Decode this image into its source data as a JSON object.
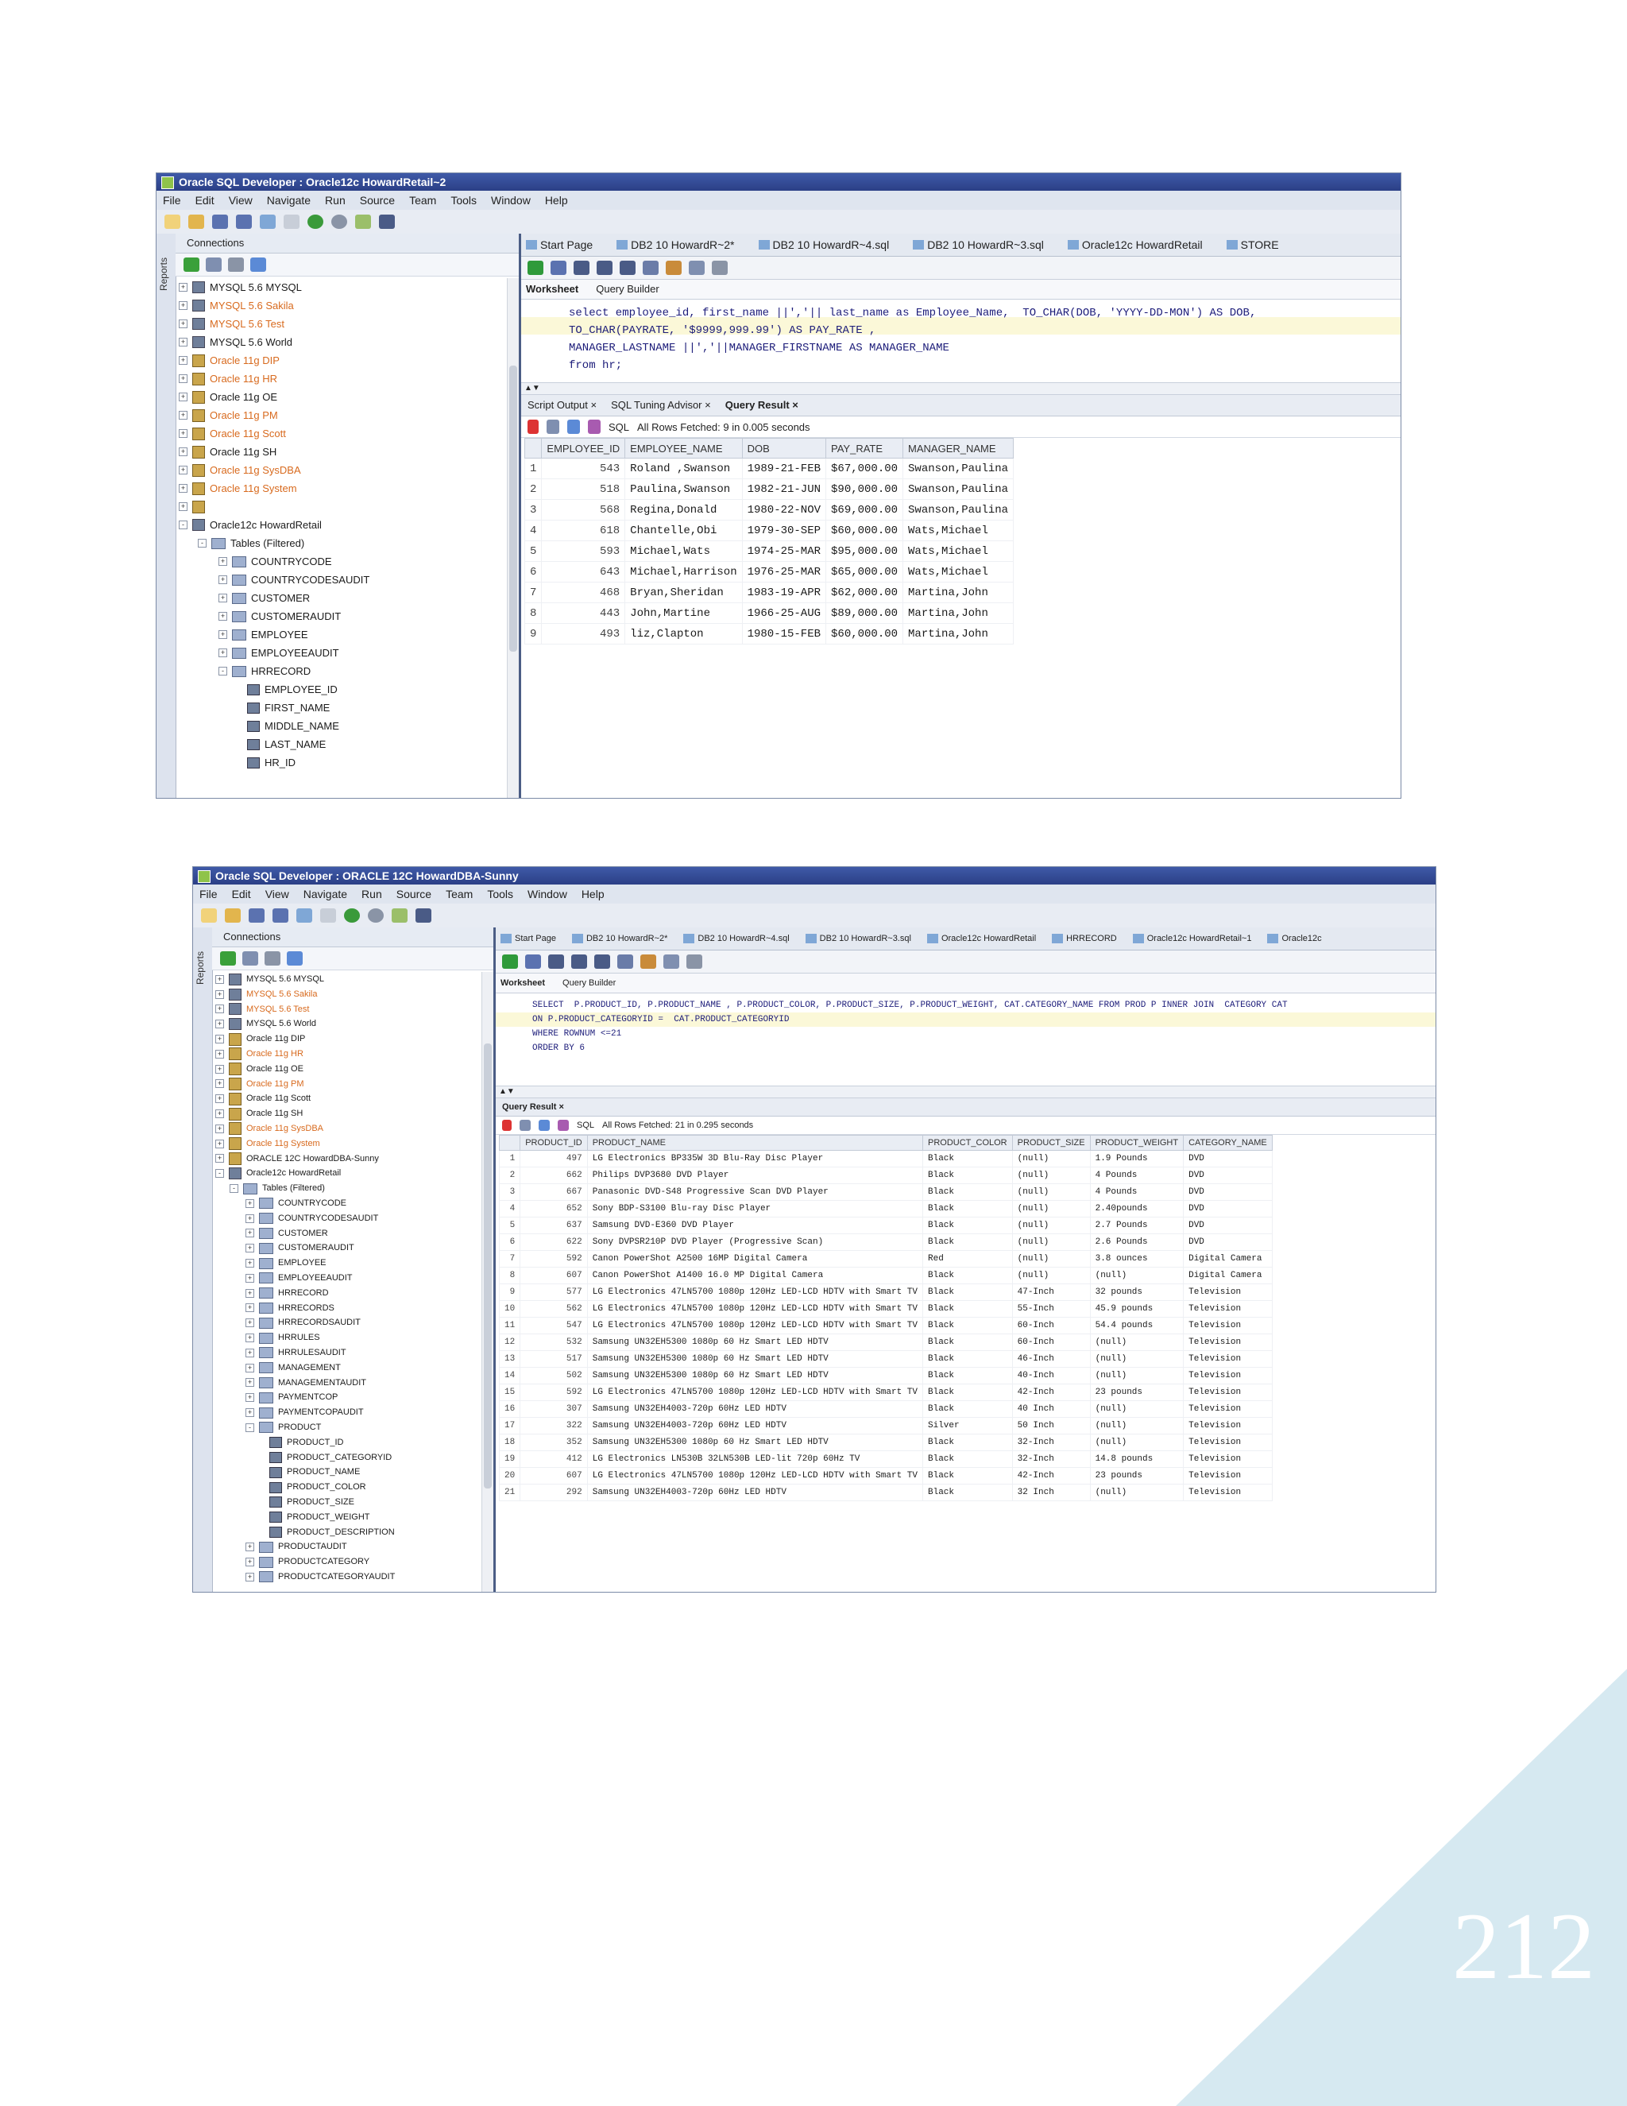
{
  "page_number": "212",
  "colors": {
    "title_bar": "#2b3f86",
    "corner_accent": "#d6e9f1",
    "orange_connection": "#d86a1e"
  },
  "screenshot1": {
    "title": "Oracle SQL Developer : Oracle12c HowardRetail~2",
    "menu": [
      "File",
      "Edit",
      "View",
      "Navigate",
      "Run",
      "Source",
      "Team",
      "Tools",
      "Window",
      "Help"
    ],
    "side_tab": "Reports",
    "connections_title": "Connections",
    "tree": [
      {
        "label": "MYSQL 5.6 MYSQL",
        "style": "dark"
      },
      {
        "label": "MYSQL 5.6 Sakila",
        "style": "orange"
      },
      {
        "label": "MYSQL 5.6 Test",
        "style": "orange"
      },
      {
        "label": "MYSQL 5.6 World",
        "style": "dark"
      },
      {
        "label": "Oracle 11g DIP",
        "style": "orange"
      },
      {
        "label": "Oracle 11g HR",
        "style": "orange"
      },
      {
        "label": "Oracle 11g OE",
        "style": "dark"
      },
      {
        "label": "Oracle 11g PM",
        "style": "orange"
      },
      {
        "label": "Oracle 11g Scott",
        "style": "orange"
      },
      {
        "label": "Oracle 11g SH",
        "style": "dark"
      },
      {
        "label": "Oracle 11g SysDBA",
        "style": "orange"
      },
      {
        "label": "Oracle 11g System",
        "style": "orange"
      },
      {
        "label": "",
        "style": "dark"
      },
      {
        "label": "Oracle12c HowardRetail",
        "style": "dark"
      },
      {
        "label": "Tables (Filtered)",
        "style": "dark"
      },
      {
        "label": "COUNTRYCODE",
        "style": "dark"
      },
      {
        "label": "COUNTRYCODESAUDIT",
        "style": "dark"
      },
      {
        "label": "CUSTOMER",
        "style": "dark"
      },
      {
        "label": "CUSTOMERAUDIT",
        "style": "dark"
      },
      {
        "label": "EMPLOYEE",
        "style": "dark"
      },
      {
        "label": "EMPLOYEEAUDIT",
        "style": "dark"
      },
      {
        "label": "HRRECORD",
        "style": "dark"
      },
      {
        "label": "EMPLOYEE_ID",
        "style": "dark"
      },
      {
        "label": "FIRST_NAME",
        "style": "dark"
      },
      {
        "label": "MIDDLE_NAME",
        "style": "dark"
      },
      {
        "label": "LAST_NAME",
        "style": "dark"
      },
      {
        "label": "HR_ID",
        "style": "dark"
      }
    ],
    "doc_tabs": [
      "Start Page",
      "DB2 10 HowardR~2*",
      "DB2 10 HowardR~4.sql",
      "DB2 10 HowardR~3.sql",
      "Oracle12c HowardRetail",
      "STORE"
    ],
    "sub_tabs": [
      "Worksheet",
      "Query Builder"
    ],
    "sql": [
      "select employee_id, first_name ||','|| last_name as Employee_Name,  TO_CHAR(DOB, 'YYYY-DD-MON') AS DOB,",
      "TO_CHAR(PAYRATE, '$9999,999.99') AS PAY_RATE ,",
      "MANAGER_LASTNAME ||','||MANAGER_FIRSTNAME AS MANAGER_NAME",
      "from hr;"
    ],
    "result_tabs": [
      "Script Output",
      "SQL Tuning Advisor",
      "Query Result"
    ],
    "sql_label": "SQL",
    "status": "All Rows Fetched: 9 in 0.005 seconds",
    "columns": [
      "EMPLOYEE_ID",
      "EMPLOYEE_NAME",
      "DOB",
      "PAY_RATE",
      "MANAGER_NAME"
    ],
    "rows": [
      [
        "1",
        "543",
        "Roland ,Swanson",
        "1989-21-FEB",
        "$67,000.00",
        "Swanson,Paulina"
      ],
      [
        "2",
        "518",
        "Paulina,Swanson",
        "1982-21-JUN",
        "$90,000.00",
        "Swanson,Paulina"
      ],
      [
        "3",
        "568",
        "Regina,Donald",
        "1980-22-NOV",
        "$69,000.00",
        "Swanson,Paulina"
      ],
      [
        "4",
        "618",
        "Chantelle,Obi",
        "1979-30-SEP",
        "$60,000.00",
        "Wats,Michael"
      ],
      [
        "5",
        "593",
        "Michael,Wats",
        "1974-25-MAR",
        "$95,000.00",
        "Wats,Michael"
      ],
      [
        "6",
        "643",
        "Michael,Harrison",
        "1976-25-MAR",
        "$65,000.00",
        "Wats,Michael"
      ],
      [
        "7",
        "468",
        "Bryan,Sheridan",
        "1983-19-APR",
        "$62,000.00",
        "Martina,John"
      ],
      [
        "8",
        "443",
        "John,Martine",
        "1966-25-AUG",
        "$89,000.00",
        "Martina,John"
      ],
      [
        "9",
        "493",
        "liz,Clapton",
        "1980-15-FEB",
        "$60,000.00",
        "Martina,John"
      ]
    ]
  },
  "screenshot2": {
    "title": "Oracle SQL Developer : ORACLE 12C HowardDBA-Sunny",
    "menu": [
      "File",
      "Edit",
      "View",
      "Navigate",
      "Run",
      "Source",
      "Team",
      "Tools",
      "Window",
      "Help"
    ],
    "side_tab": "Reports",
    "connections_title": "Connections",
    "tree": [
      {
        "label": "MYSQL 5.6 MYSQL",
        "style": "dark"
      },
      {
        "label": "MYSQL 5.6 Sakila",
        "style": "orange"
      },
      {
        "label": "MYSQL 5.6 Test",
        "style": "orange"
      },
      {
        "label": "MYSQL 5.6 World",
        "style": "dark"
      },
      {
        "label": "Oracle 11g DIP",
        "style": "dark"
      },
      {
        "label": "Oracle 11g HR",
        "style": "orange"
      },
      {
        "label": "Oracle 11g OE",
        "style": "dark"
      },
      {
        "label": "Oracle 11g PM",
        "style": "orange"
      },
      {
        "label": "Oracle 11g Scott",
        "style": "dark"
      },
      {
        "label": "Oracle 11g SH",
        "style": "dark"
      },
      {
        "label": "Oracle 11g SysDBA",
        "style": "orange"
      },
      {
        "label": "Oracle 11g System",
        "style": "orange"
      },
      {
        "label": "ORACLE 12C HowardDBA-Sunny",
        "style": "dark"
      },
      {
        "label": "Oracle12c HowardRetail",
        "style": "dark"
      },
      {
        "label": "Tables (Filtered)",
        "style": "dark"
      },
      {
        "label": "COUNTRYCODE",
        "style": "dark"
      },
      {
        "label": "COUNTRYCODESAUDIT",
        "style": "dark"
      },
      {
        "label": "CUSTOMER",
        "style": "dark"
      },
      {
        "label": "CUSTOMERAUDIT",
        "style": "dark"
      },
      {
        "label": "EMPLOYEE",
        "style": "dark"
      },
      {
        "label": "EMPLOYEEAUDIT",
        "style": "dark"
      },
      {
        "label": "HRRECORD",
        "style": "dark"
      },
      {
        "label": "HRRECORDS",
        "style": "dark"
      },
      {
        "label": "HRRECORDSAUDIT",
        "style": "dark"
      },
      {
        "label": "HRRULES",
        "style": "dark"
      },
      {
        "label": "HRRULESAUDIT",
        "style": "dark"
      },
      {
        "label": "MANAGEMENT",
        "style": "dark"
      },
      {
        "label": "MANAGEMENTAUDIT",
        "style": "dark"
      },
      {
        "label": "PAYMENTCOP",
        "style": "dark"
      },
      {
        "label": "PAYMENTCOPAUDIT",
        "style": "dark"
      },
      {
        "label": "PRODUCT",
        "style": "dark"
      },
      {
        "label": "PRODUCT_ID",
        "style": "dark"
      },
      {
        "label": "PRODUCT_CATEGORYID",
        "style": "dark"
      },
      {
        "label": "PRODUCT_NAME",
        "style": "dark"
      },
      {
        "label": "PRODUCT_COLOR",
        "style": "dark"
      },
      {
        "label": "PRODUCT_SIZE",
        "style": "dark"
      },
      {
        "label": "PRODUCT_WEIGHT",
        "style": "dark"
      },
      {
        "label": "PRODUCT_DESCRIPTION",
        "style": "dark"
      },
      {
        "label": "PRODUCTAUDIT",
        "style": "dark"
      },
      {
        "label": "PRODUCTCATEGORY",
        "style": "dark"
      },
      {
        "label": "PRODUCTCATEGORYAUDIT",
        "style": "dark"
      }
    ],
    "doc_tabs": [
      "Start Page",
      "DB2 10 HowardR~2*",
      "DB2 10 HowardR~4.sql",
      "DB2 10 HowardR~3.sql",
      "Oracle12c HowardRetail",
      "HRRECORD",
      "Oracle12c HowardRetail~1",
      "Oracle12c"
    ],
    "sub_tabs": [
      "Worksheet",
      "Query Builder"
    ],
    "sql": [
      "SELECT  P.PRODUCT_ID, P.PRODUCT_NAME , P.PRODUCT_COLOR, P.PRODUCT_SIZE, P.PRODUCT_WEIGHT, CAT.CATEGORY_NAME FROM PROD P INNER JOIN  CATEGORY CAT",
      "ON P.PRODUCT_CATEGORYID =  CAT.PRODUCT_CATEGORYID",
      "WHERE ROWNUM <=21",
      "ORDER BY 6"
    ],
    "result_tabs": [
      "Query Result"
    ],
    "sql_label": "SQL",
    "status": "All Rows Fetched: 21 in 0.295 seconds",
    "columns": [
      "PRODUCT_ID",
      "PRODUCT_NAME",
      "PRODUCT_COLOR",
      "PRODUCT_SIZE",
      "PRODUCT_WEIGHT",
      "CATEGORY_NAME"
    ],
    "rows": [
      [
        "1",
        "497",
        "LG Electronics BP335W 3D Blu-Ray Disc Player",
        "Black",
        "(null)",
        "1.9 Pounds",
        "DVD"
      ],
      [
        "2",
        "662",
        "Philips DVP3680 DVD Player",
        "Black",
        "(null)",
        "4 Pounds",
        "DVD"
      ],
      [
        "3",
        "667",
        "Panasonic DVD-S48 Progressive Scan DVD Player",
        "Black",
        "(null)",
        "4 Pounds",
        "DVD"
      ],
      [
        "4",
        "652",
        "Sony BDP-S3100 Blu-ray Disc Player",
        "Black",
        "(null)",
        "2.40pounds",
        "DVD"
      ],
      [
        "5",
        "637",
        "Samsung DVD-E360 DVD Player",
        "Black",
        "(null)",
        "2.7 Pounds",
        "DVD"
      ],
      [
        "6",
        "622",
        "Sony DVPSR210P DVD Player (Progressive Scan)",
        "Black",
        "(null)",
        "2.6 Pounds",
        "DVD"
      ],
      [
        "7",
        "592",
        "Canon PowerShot A2500 16MP Digital Camera",
        "Red",
        "(null)",
        "3.8 ounces",
        "Digital Camera"
      ],
      [
        "8",
        "607",
        "Canon PowerShot A1400 16.0 MP Digital Camera",
        "Black",
        "(null)",
        "(null)",
        "Digital Camera"
      ],
      [
        "9",
        "577",
        "LG Electronics 47LN5700 1080p 120Hz LED-LCD HDTV with Smart TV",
        "Black",
        "47-Inch",
        "32 pounds",
        "Television"
      ],
      [
        "10",
        "562",
        "LG Electronics 47LN5700 1080p 120Hz LED-LCD HDTV with Smart TV",
        "Black",
        "55-Inch",
        "45.9 pounds",
        "Television"
      ],
      [
        "11",
        "547",
        "LG Electronics 47LN5700 1080p 120Hz LED-LCD HDTV with Smart TV",
        "Black",
        "60-Inch",
        "54.4 pounds",
        "Television"
      ],
      [
        "12",
        "532",
        "Samsung UN32EH5300  1080p 60 Hz Smart LED HDTV",
        "Black",
        "60-Inch",
        "(null)",
        "Television"
      ],
      [
        "13",
        "517",
        "Samsung UN32EH5300  1080p 60 Hz Smart LED HDTV",
        "Black",
        "46-Inch",
        "(null)",
        "Television"
      ],
      [
        "14",
        "502",
        "Samsung UN32EH5300  1080p 60 Hz Smart LED HDTV",
        "Black",
        "40-Inch",
        "(null)",
        "Television"
      ],
      [
        "15",
        "592",
        "LG Electronics 47LN5700 1080p 120Hz LED-LCD HDTV with Smart TV",
        "Black",
        "42-Inch",
        "23 pounds",
        "Television"
      ],
      [
        "16",
        "307",
        "Samsung UN32EH4003-720p 60Hz LED HDTV",
        "Black",
        "40 Inch",
        "(null)",
        "Television"
      ],
      [
        "17",
        "322",
        "Samsung UN32EH4003-720p 60Hz LED HDTV",
        "Silver",
        "50 Inch",
        "(null)",
        "Television"
      ],
      [
        "18",
        "352",
        "Samsung UN32EH5300  1080p 60 Hz Smart LED HDTV",
        "Black",
        "32-Inch",
        "(null)",
        "Television"
      ],
      [
        "19",
        "412",
        "LG Electronics LN530B 32LN530B LED-lit 720p 60Hz TV",
        "Black",
        "32-Inch",
        "14.8 pounds",
        "Television"
      ],
      [
        "20",
        "607",
        "LG Electronics 47LN5700 1080p 120Hz LED-LCD HDTV with Smart TV",
        "Black",
        "42-Inch",
        "23 pounds",
        "Television"
      ],
      [
        "21",
        "292",
        "Samsung UN32EH4003-720p 60Hz LED HDTV",
        "Black",
        "32 Inch",
        "(null)",
        "Television"
      ]
    ]
  }
}
